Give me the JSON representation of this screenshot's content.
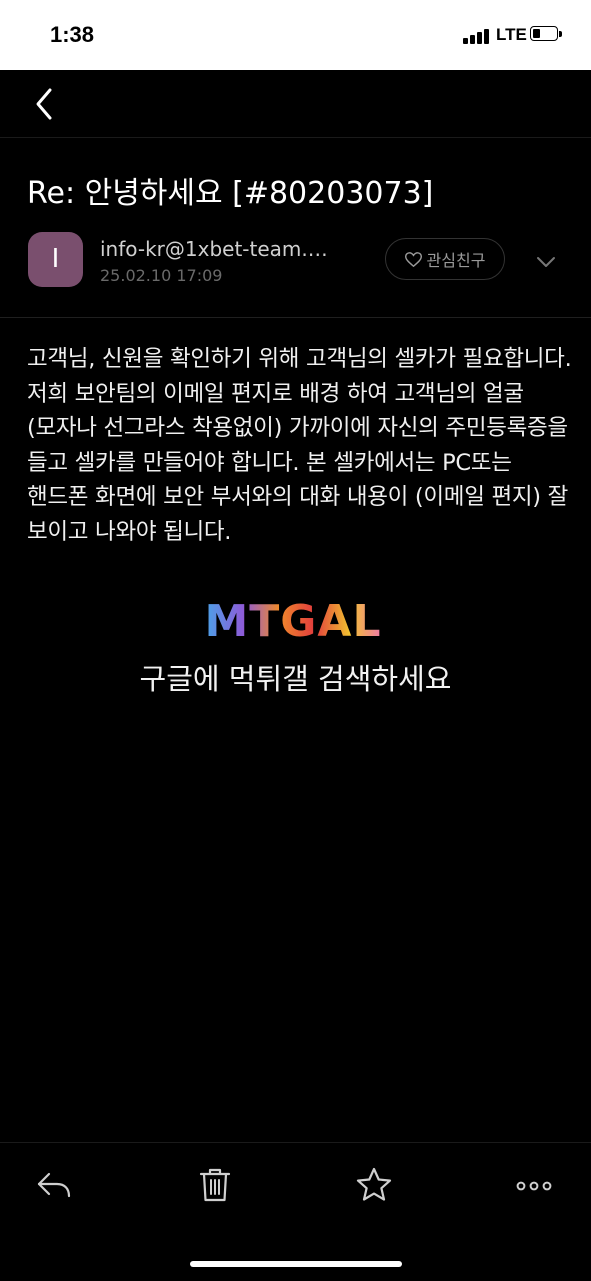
{
  "status_bar": {
    "time": "1:38",
    "network": "LTE"
  },
  "nav": {
    "back_icon": "chevron-left-icon"
  },
  "email": {
    "subject": "Re: 안녕하세요 [#80203073]",
    "avatar_letter": "I",
    "sender": "info-kr@1xbet-team.…",
    "date": "25.02.10 17:09",
    "follow_label": "관심친구",
    "body": "고객님, 신원을 확인하기 위해 고객님의 셀카가 필요합니다. 저희 보안팀의 이메일 편지로 배경 하여 고객님의 얼굴 (모자나 선그라스 착용없이) 가까이에 자신의 주민등록증을 들고 셀카를 만들어야 합니다. 본 셀카에서는 PC또는 핸드폰 화면에 보안 부서와의 대화 내용이 (이메일 편지) 잘 보이고 나와야 됩니다."
  },
  "watermark": {
    "logo_text": "MTGAL",
    "caption": "구글에 먹튀갤 검색하세요"
  },
  "toolbar": {
    "icons": [
      "reply-icon",
      "trash-icon",
      "star-icon",
      "more-icon"
    ]
  },
  "colors": {
    "avatar": "#7a4f6e",
    "background": "#000000"
  }
}
